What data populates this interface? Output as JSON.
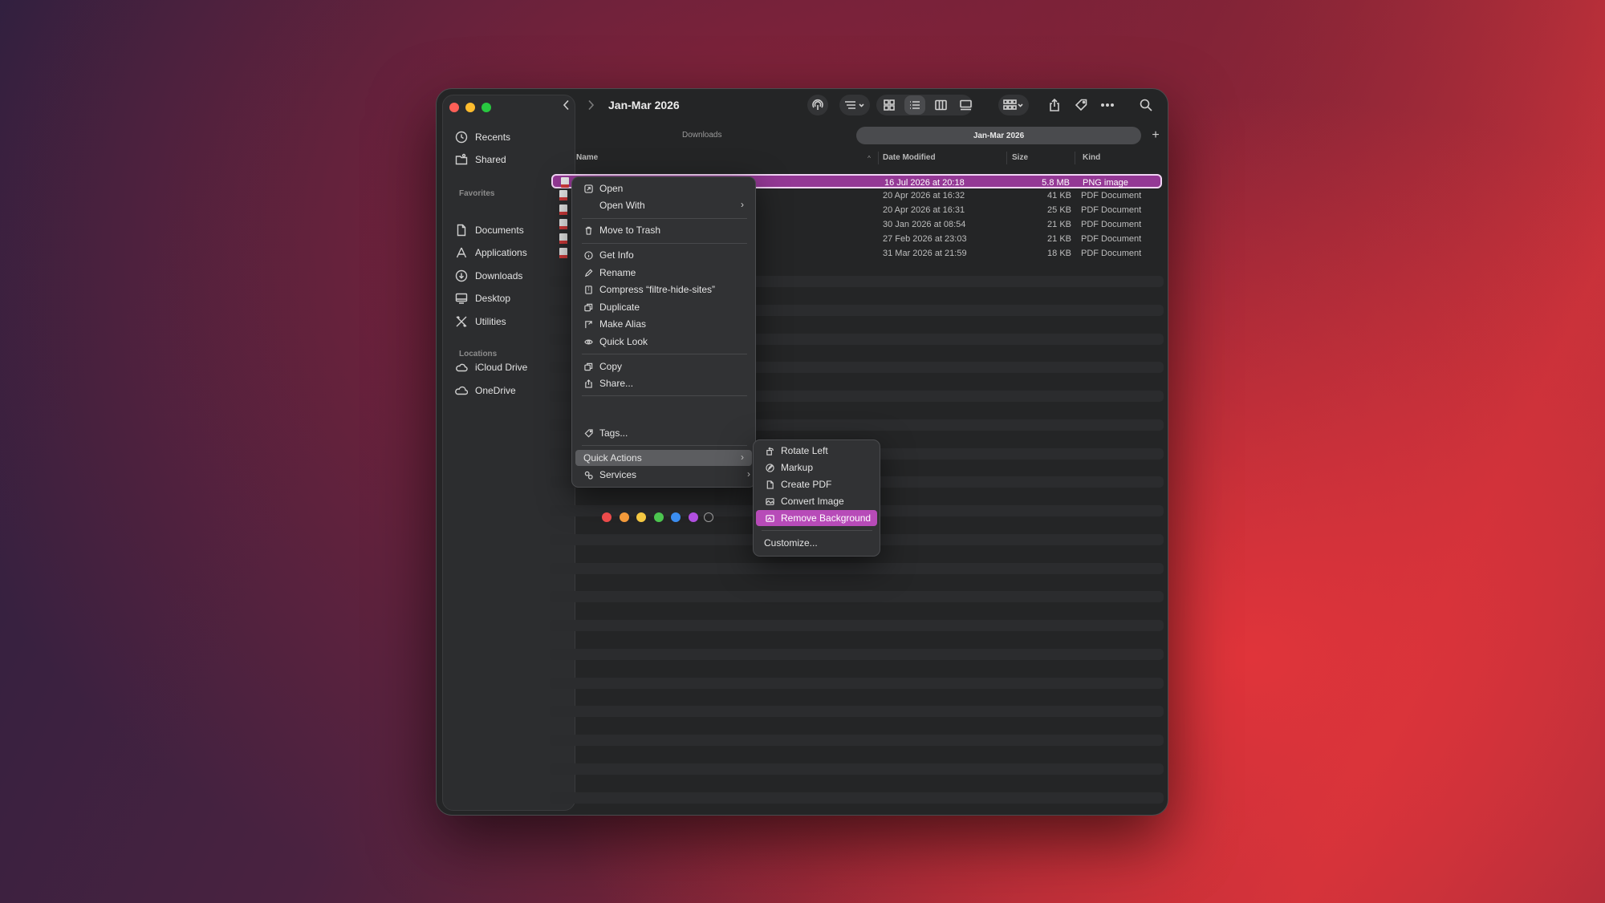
{
  "window": {
    "title": "Jan-Mar 2026"
  },
  "sidebar": {
    "top_items": [
      {
        "label": "Recents",
        "icon": "clock-icon"
      },
      {
        "label": "Shared",
        "icon": "shared-folder-icon"
      }
    ],
    "favorites_header": "Favorites",
    "favorites": [
      {
        "label": "Documents",
        "icon": "document-icon"
      },
      {
        "label": "Applications",
        "icon": "applications-icon"
      },
      {
        "label": "Downloads",
        "icon": "download-icon"
      },
      {
        "label": "Desktop",
        "icon": "desktop-icon"
      },
      {
        "label": "Utilities",
        "icon": "utilities-icon"
      }
    ],
    "locations_header": "Locations",
    "locations": [
      {
        "label": "iCloud Drive",
        "icon": "cloud-icon"
      },
      {
        "label": "OneDrive",
        "icon": "onedrive-icon"
      }
    ]
  },
  "tabs": {
    "inactive": "Downloads",
    "active": "Jan-Mar 2026",
    "add": "+"
  },
  "columns": {
    "name": "Name",
    "date": "Date Modified",
    "size": "Size",
    "kind": "Kind"
  },
  "files": [
    {
      "date": "16 Jul 2026 at 20:18",
      "size": "5.8 MB",
      "kind": "PNG image",
      "selected": true
    },
    {
      "date": "20 Apr 2026 at 16:32",
      "size": "41 KB",
      "kind": "PDF Document"
    },
    {
      "date": "20 Apr 2026 at 16:31",
      "size": "25 KB",
      "kind": "PDF Document"
    },
    {
      "date": "30 Jan 2026 at 08:54",
      "size": "21 KB",
      "kind": "PDF Document"
    },
    {
      "date": "27 Feb 2026 at 23:03",
      "size": "21 KB",
      "kind": "PDF Document"
    },
    {
      "date": "31 Mar 2026 at 21:59",
      "size": "18 KB",
      "kind": "PDF Document"
    }
  ],
  "context_menu": {
    "open": "Open",
    "open_with": "Open With",
    "move_to_trash": "Move to Trash",
    "get_info": "Get Info",
    "rename": "Rename",
    "compress": "Compress “filtre-hide-sites”",
    "duplicate": "Duplicate",
    "make_alias": "Make Alias",
    "quick_look": "Quick Look",
    "copy": "Copy",
    "share": "Share...",
    "tag_colors": [
      "#ec4b4b",
      "#f39a3a",
      "#f5c842",
      "#4cc54f",
      "#3b8ef0",
      "#b14fe0"
    ],
    "tags": "Tags...",
    "quick_actions": "Quick Actions",
    "services": "Services"
  },
  "quick_actions_menu": {
    "rotate_left": "Rotate Left",
    "markup": "Markup",
    "create_pdf": "Create PDF",
    "convert_image": "Convert Image",
    "remove_background": "Remove Background",
    "customize": "Customize..."
  },
  "colors": {
    "accent": "#943895",
    "highlight": "#b74bb8"
  }
}
